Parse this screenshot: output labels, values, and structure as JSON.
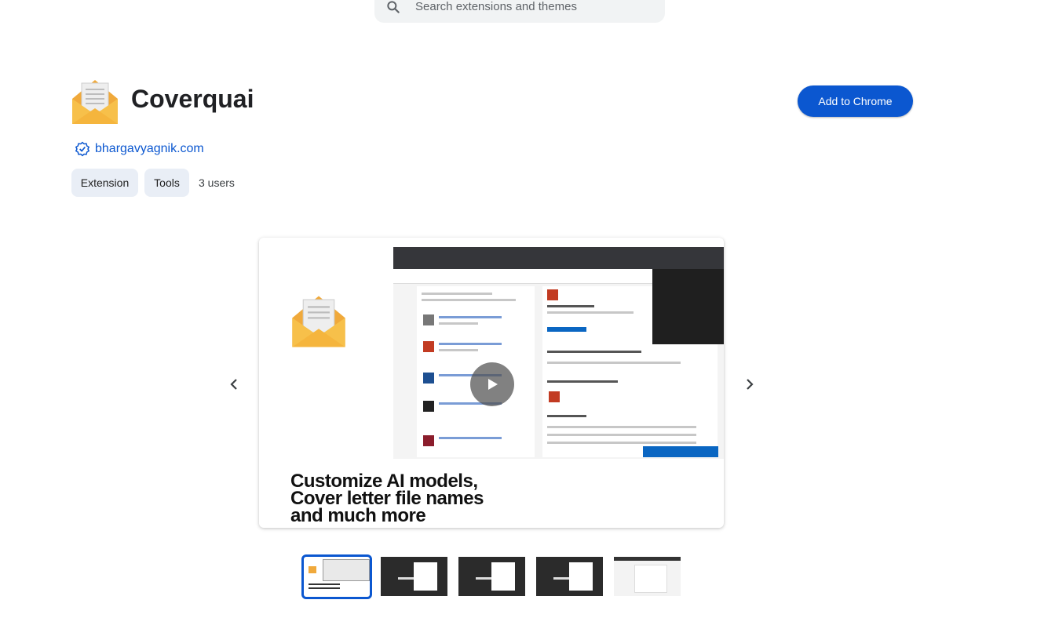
{
  "search": {
    "placeholder": "Search extensions and themes"
  },
  "extension": {
    "name": "Coverquai",
    "publisher": "bhargavyagnik.com",
    "add_button": "Add to Chrome",
    "chips": [
      "Extension",
      "Tools"
    ],
    "users": "3 users"
  },
  "slide": {
    "caption_lines": [
      "Customize AI models,",
      "Cover letter file names",
      "and much more"
    ]
  },
  "icons": [
    "search-icon",
    "verified-badge-icon",
    "chevron-left-icon",
    "chevron-right-icon",
    "play-icon",
    "envelope-logo-icon"
  ],
  "colors": {
    "accent": "#0b57d0",
    "chip_bg": "#e9eef6",
    "search_bg": "#f1f3f4"
  }
}
